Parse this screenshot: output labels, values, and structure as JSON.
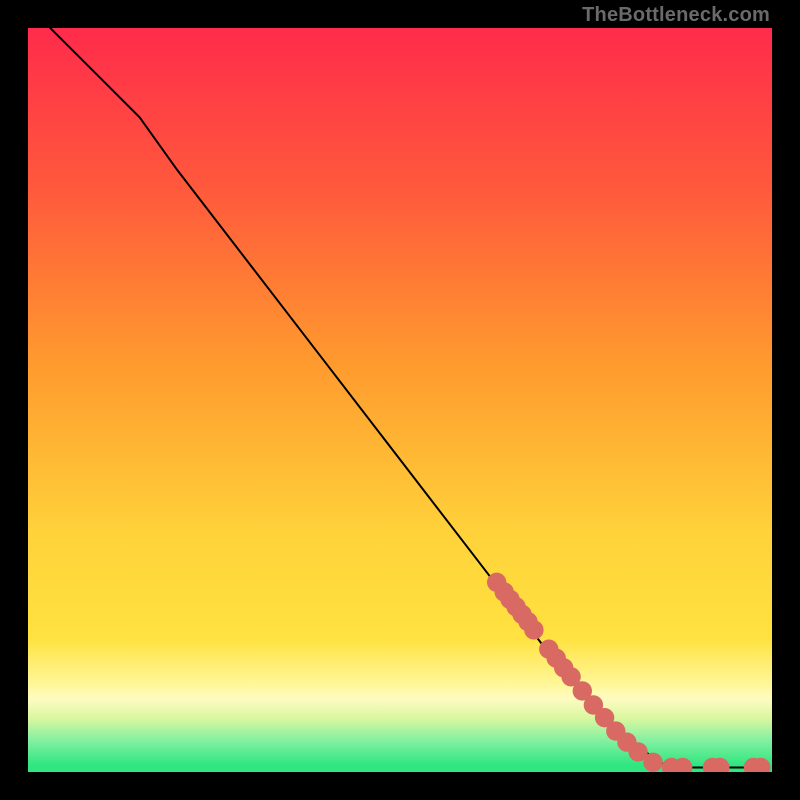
{
  "watermark": "TheBottleneck.com",
  "colors": {
    "gradient_top": "#ff2b4b",
    "gradient_yellow": "#ffe240",
    "gradient_green": "#2fe680",
    "curve": "#000000",
    "marker_fill": "#d96a63",
    "marker_stroke": "#8f3f3a"
  },
  "chart_data": {
    "type": "line",
    "title": "",
    "xlabel": "",
    "ylabel": "",
    "xlim": [
      0,
      100
    ],
    "ylim": [
      0,
      100
    ],
    "curve": [
      {
        "x": 3,
        "y": 100
      },
      {
        "x": 10,
        "y": 93
      },
      {
        "x": 15,
        "y": 88
      },
      {
        "x": 20,
        "y": 81
      },
      {
        "x": 30,
        "y": 68
      },
      {
        "x": 40,
        "y": 55
      },
      {
        "x": 50,
        "y": 42
      },
      {
        "x": 60,
        "y": 29
      },
      {
        "x": 70,
        "y": 16
      },
      {
        "x": 80,
        "y": 5
      },
      {
        "x": 85,
        "y": 1.2
      },
      {
        "x": 88,
        "y": 0.6
      },
      {
        "x": 92,
        "y": 0.6
      },
      {
        "x": 95,
        "y": 0.6
      },
      {
        "x": 98,
        "y": 0.6
      }
    ],
    "markers": [
      {
        "x": 63,
        "y": 25.5
      },
      {
        "x": 64,
        "y": 24.2
      },
      {
        "x": 64.8,
        "y": 23.2
      },
      {
        "x": 65.6,
        "y": 22.2
      },
      {
        "x": 66.4,
        "y": 21.2
      },
      {
        "x": 67.2,
        "y": 20.2
      },
      {
        "x": 68.0,
        "y": 19.1
      },
      {
        "x": 70.0,
        "y": 16.5
      },
      {
        "x": 71.0,
        "y": 15.3
      },
      {
        "x": 72.0,
        "y": 14.0
      },
      {
        "x": 73.0,
        "y": 12.8
      },
      {
        "x": 74.5,
        "y": 10.9
      },
      {
        "x": 76.0,
        "y": 9.0
      },
      {
        "x": 77.5,
        "y": 7.3
      },
      {
        "x": 79.0,
        "y": 5.5
      },
      {
        "x": 80.5,
        "y": 4.0
      },
      {
        "x": 82.0,
        "y": 2.7
      },
      {
        "x": 84.0,
        "y": 1.3
      },
      {
        "x": 86.5,
        "y": 0.6
      },
      {
        "x": 88.0,
        "y": 0.6
      },
      {
        "x": 92.0,
        "y": 0.6
      },
      {
        "x": 93.0,
        "y": 0.6
      },
      {
        "x": 97.5,
        "y": 0.6
      },
      {
        "x": 98.5,
        "y": 0.6
      }
    ],
    "marker_radius": 1.3,
    "green_band_fraction": 0.045
  }
}
